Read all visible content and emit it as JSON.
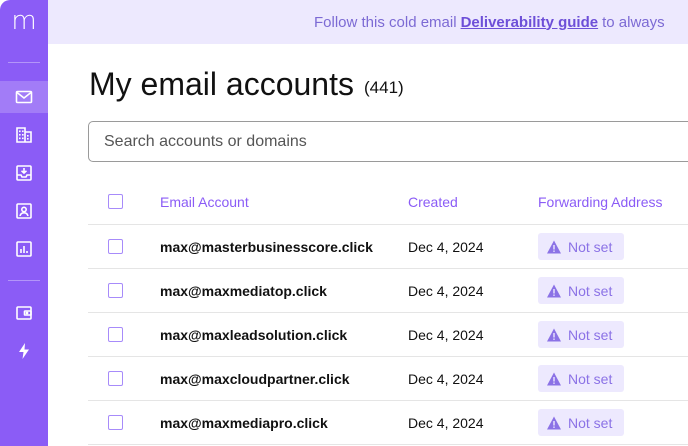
{
  "sidebar": {
    "logo": "m",
    "items": [
      {
        "icon": "mail-icon",
        "active": true
      },
      {
        "icon": "building-icon",
        "active": false
      },
      {
        "icon": "inbox-download-icon",
        "active": false
      },
      {
        "icon": "contact-card-icon",
        "active": false
      },
      {
        "icon": "bar-chart-icon",
        "active": false
      },
      {
        "icon": "wallet-icon",
        "active": false
      },
      {
        "icon": "lightning-icon",
        "active": false
      }
    ]
  },
  "banner": {
    "prefix": "Follow this cold email",
    "link": "Deliverability guide",
    "suffix": "to always"
  },
  "page": {
    "title": "My email accounts",
    "count": "(441)"
  },
  "search": {
    "placeholder": "Search accounts or domains"
  },
  "table": {
    "headers": {
      "email": "Email Account",
      "created": "Created",
      "forwarding": "Forwarding Address"
    },
    "rows": [
      {
        "email": "max@masterbusinesscore.click",
        "created": "Dec 4, 2024",
        "forwarding": "Not set"
      },
      {
        "email": "max@maxmediatop.click",
        "created": "Dec 4, 2024",
        "forwarding": "Not set"
      },
      {
        "email": "max@maxleadsolution.click",
        "created": "Dec 4, 2024",
        "forwarding": "Not set"
      },
      {
        "email": "max@maxcloudpartner.click",
        "created": "Dec 4, 2024",
        "forwarding": "Not set"
      },
      {
        "email": "max@maxmediapro.click",
        "created": "Dec 4, 2024",
        "forwarding": "Not set"
      }
    ]
  },
  "colors": {
    "accent": "#8b5cf6",
    "banner_bg": "#ede9fe",
    "badge_text": "#8b72e6"
  }
}
